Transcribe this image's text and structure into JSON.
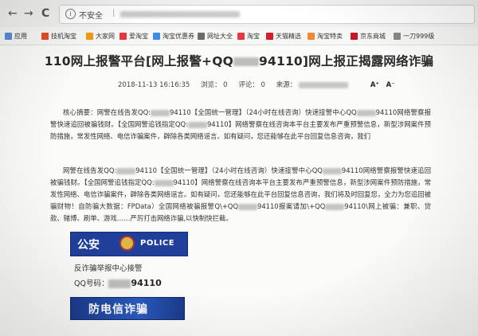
{
  "browser": {
    "nav_back": "←",
    "nav_forward": "→",
    "nav_reload": "C",
    "security_label": "不安全",
    "bookmarks": [
      {
        "label": "应用",
        "color": "#5a8cd8"
      },
      {
        "label": "技机淘宝",
        "color": "#e44d26"
      },
      {
        "label": "大家网",
        "color": "#f39c12"
      },
      {
        "label": "爱淘宝",
        "color": "#e6393f"
      },
      {
        "label": "淘宝优惠券",
        "color": "#3a8ee6"
      },
      {
        "label": "网址大全",
        "color": "#6c6c6c"
      },
      {
        "label": "淘宝",
        "color": "#e6393f"
      },
      {
        "label": "天猫精选",
        "color": "#d5202b"
      },
      {
        "label": "淘宝特卖",
        "color": "#f0883a"
      },
      {
        "label": "京东商城",
        "color": "#c81623"
      },
      {
        "label": "一刀999级",
        "color": "#888888"
      }
    ]
  },
  "article": {
    "title_prefix": "110网上报警平台[网上报警+QQ",
    "title_suffix": "94110]网上报正揭露网络诈骗",
    "date": "2018-11-13 16:16:35",
    "views": "浏览： 0",
    "comments": "评论： 0",
    "source": "来源：",
    "font_large": "A⁺",
    "font_small": "A⁻",
    "summary": [
      "核心摘要：网警在线告发QQ:",
      "94110【全国统一管理】（24小时在线咨询）快速接警中心QQ",
      "94110网络警察报警快速追回被骗钱财。【全国网警追钱指定QQ:",
      "94110】网络警察在线咨询本平台主要发布严重预警信息，新型涉网案件预防措施，常发性网络、电信诈骗案件，辟除各类网络谣言。如有疑问，您还能够在此平台回复信息咨询，我们"
    ],
    "body": [
      "网警在线告发QQ:",
      "94110【全国统一管理】（24小时在线咨询）快速接警中心QQ",
      "94110网络警察报警快速追回被骗钱财。【全国网警追钱指定QQ:",
      "94110】网络警察在线咨询本平台主要发布严重预警信息，新型涉网案件预防措施，常发性网络、电信诈骗案件，辟除各类网络谣言。如有疑问，您还能够在此平台回复信息咨询，我们将及时回复您，全力为您追回被骗财物！自防骗大数据：FPData）全国网络被骗报警Q\\+QQ",
      "94110报案请加\\+QQ",
      "94110\\网上被骗：兼职、贷款、赌博、刷单、游戏……严厉打击网络诈骗,以快制快拦截。"
    ],
    "police_banner_cn": "公安",
    "police_banner_en": "POLICE",
    "report_center": "反诈骗举报中心接警",
    "qq_label": "QQ号码：",
    "qq_number_tail": "94110",
    "antifraud_banner": "防电信诈骗"
  }
}
